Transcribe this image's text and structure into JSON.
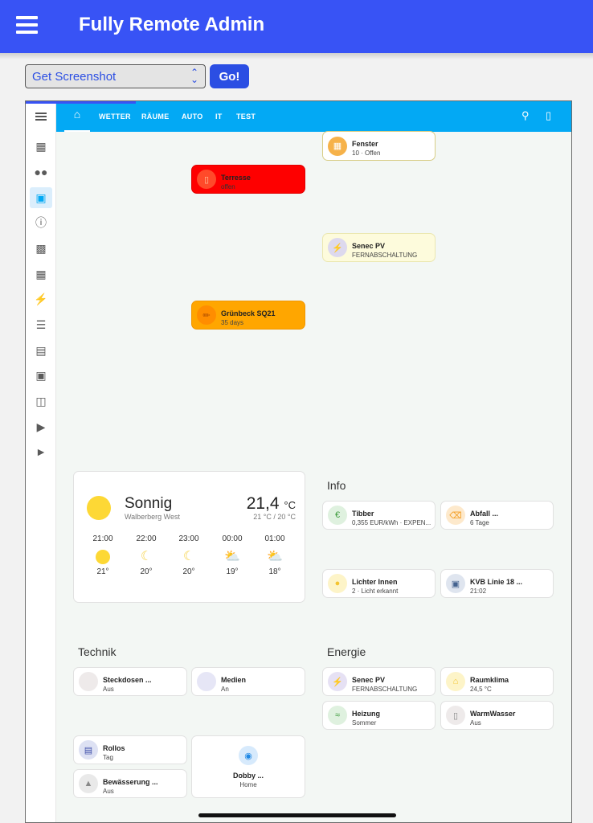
{
  "app": {
    "title": "Fully Remote Admin"
  },
  "controls": {
    "select_value": "Get Screenshot",
    "go_label": "Go!"
  },
  "ha": {
    "tabs": [
      "WETTER",
      "RÄUME",
      "AUTO",
      "IT",
      "TEST"
    ],
    "sidebar_icons": [
      "dashboard-icon",
      "people-icon",
      "display-icon",
      "info-icon",
      "account-box-icon",
      "solar-panel-icon",
      "flash-icon",
      "list-icon",
      "chart-icon",
      "calendar-icon",
      "meter-icon",
      "media-icon",
      "play-icon"
    ],
    "alerts": [
      {
        "name": "Fenster",
        "state": "10 · Offen",
        "color": "#efe49b"
      },
      {
        "name": "Terresse",
        "state": "offen",
        "color": "#fe0000"
      },
      {
        "name": "Senec PV",
        "state": "FERNABSCHALTUNG",
        "color": "#fdfbdc"
      },
      {
        "name": "Grünbeck SQ21",
        "state": "35 days",
        "color": "#ffa600"
      }
    ],
    "weather": {
      "condition": "Sonnig",
      "location": "Walberberg West",
      "temp": "21,4",
      "unit": "°C",
      "range": "21 °C / 20 °C",
      "forecast": [
        {
          "time": "21:00",
          "icon": "sun-icon",
          "temp": "21°"
        },
        {
          "time": "22:00",
          "icon": "moon-icon",
          "temp": "20°"
        },
        {
          "time": "23:00",
          "icon": "moon-icon",
          "temp": "20°"
        },
        {
          "time": "00:00",
          "icon": "cloud-sun-icon",
          "temp": "19°"
        },
        {
          "time": "01:00",
          "icon": "cloud-sun-icon",
          "temp": "18°"
        }
      ]
    },
    "info": {
      "title": "Info",
      "tiles": [
        {
          "name": "Tibber",
          "state": "0,355 EUR/kWh · EXPEN..."
        },
        {
          "name": "Abfall ...",
          "state": "6 Tage"
        },
        {
          "name": "Lichter Innen",
          "state": "2 · Licht erkannt"
        },
        {
          "name": "KVB Linie 18 ...",
          "state": "21:02"
        }
      ]
    },
    "technik": {
      "title": "Technik",
      "tiles": [
        {
          "name": "Steckdosen ...",
          "state": "Aus"
        },
        {
          "name": "Medien",
          "state": "An"
        },
        {
          "name": "Rollos",
          "state": "Tag"
        },
        {
          "name": "Bewässerung ...",
          "state": "Aus"
        },
        {
          "name": "Dobby ...",
          "state": "Home"
        }
      ]
    },
    "energie": {
      "title": "Energie",
      "tiles": [
        {
          "name": "Senec PV",
          "state": "FERNABSCHALTUNG"
        },
        {
          "name": "Raumklima",
          "state": "24,5 °C"
        },
        {
          "name": "Heizung",
          "state": "Sommer"
        },
        {
          "name": "WarmWasser",
          "state": "Aus"
        }
      ]
    }
  }
}
